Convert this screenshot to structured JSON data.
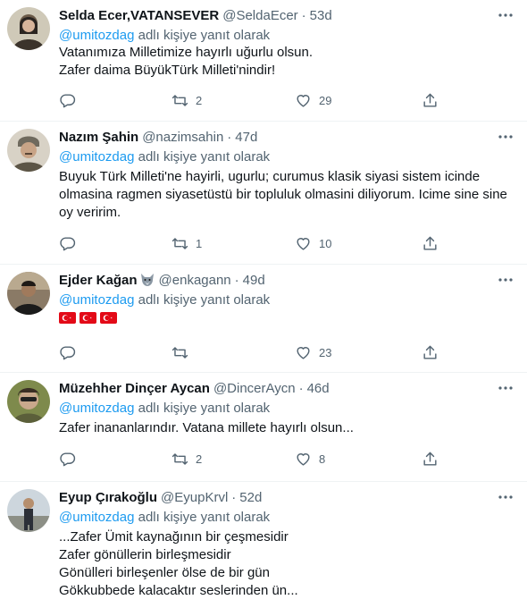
{
  "reply_prefix_suffix": "adlı kişiye yanıt olarak",
  "tweets": [
    {
      "name": "Selda Ecer,VATANSEVER",
      "handle": "@SeldaEcer",
      "time": "53d",
      "mention": "@umitozdag",
      "lines": [
        "Vatanımıza Milletimize hayırlı uğurlu olsun.",
        "Zafer daima BüyükTürk Milleti'nindir!"
      ],
      "reply_count": "",
      "retweet_count": "2",
      "like_count": "29"
    },
    {
      "name": "Nazım Şahin",
      "handle": "@nazimsahin",
      "time": "47d",
      "mention": "@umitozdag",
      "lines": [
        "Buyuk Türk Milleti'ne hayirli, ugurlu; curumus klasik siyasi sistem icinde",
        "olmasina ragmen siyasetüstü bir topluluk olmasini diliyorum. Icime sine sine",
        "oy veririm."
      ],
      "reply_count": "",
      "retweet_count": "1",
      "like_count": "10"
    },
    {
      "name": "Ejder Kağan",
      "name_emoji": "wolf-emoji",
      "handle": "@enkagann",
      "time": "49d",
      "mention": "@umitozdag",
      "flags": [
        "turkey-flag",
        "turkey-flag",
        "turkey-flag"
      ],
      "reply_count": "",
      "retweet_count": "",
      "like_count": "23"
    },
    {
      "name": "Müzehher Dinçer Aycan",
      "handle": "@DincerAycn",
      "time": "46d",
      "mention": "@umitozdag",
      "lines": [
        "Zafer inananlarındır. Vatana millete hayırlı olsun..."
      ],
      "reply_count": "",
      "retweet_count": "2",
      "like_count": "8"
    },
    {
      "name": "Eyup Çırakoğlu",
      "handle": "@EyupKrvl",
      "time": "52d",
      "mention": "@umitozdag",
      "lines": [
        "...Zafer Ümit kaynağının bir çeşmesidir",
        "Zafer gönüllerin birleşmesidir",
        "Gönülleri birleşenler ölse de bir gün",
        "Gökkubbede kalacaktır seslerinden ün..."
      ]
    }
  ],
  "colors": {
    "accent": "#1d9bf0",
    "muted": "#536471",
    "text": "#0f1419",
    "divider": "#eff3f4"
  },
  "icons": {
    "reply": "reply-icon",
    "retweet": "retweet-icon",
    "like": "like-icon",
    "share": "share-icon",
    "more": "more-icon"
  }
}
